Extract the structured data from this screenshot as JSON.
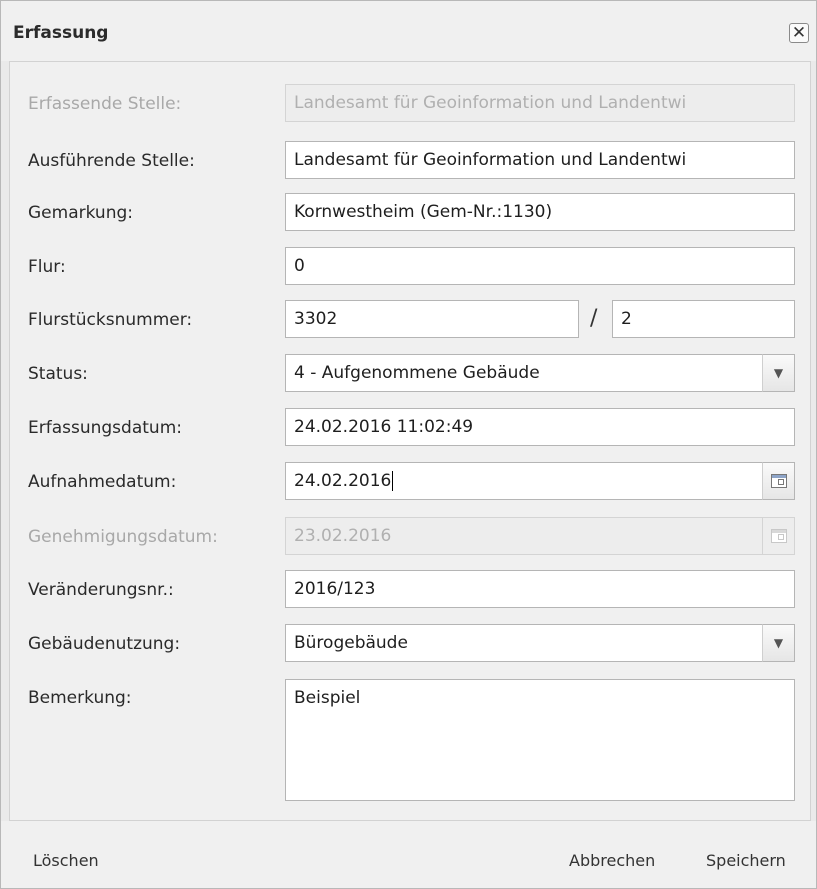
{
  "window": {
    "title": "Erfassung",
    "close_symbol": "✕"
  },
  "form": {
    "erfassende_stelle": {
      "label": "Erfassende Stelle:",
      "value": "Landesamt für Geoinformation und Landentwi"
    },
    "ausfuehrende_stelle": {
      "label": "Ausführende Stelle:",
      "value": "Landesamt für Geoinformation und Landentwi"
    },
    "gemarkung": {
      "label": "Gemarkung:",
      "value": "Kornwestheim (Gem-Nr.:1130)"
    },
    "flur": {
      "label": "Flur:",
      "value": "0"
    },
    "flurstuecksnummer": {
      "label": "Flurstücksnummer:",
      "value_main": "3302",
      "separator": "/",
      "value_sub": "2"
    },
    "status": {
      "label": "Status:",
      "value": "4 - Aufgenommene Gebäude"
    },
    "erfassungsdatum": {
      "label": "Erfassungsdatum:",
      "value": "24.02.2016 11:02:49"
    },
    "aufnahmedatum": {
      "label": "Aufnahmedatum:",
      "value": "24.02.2016"
    },
    "genehmigungsdatum": {
      "label": "Genehmigungsdatum:",
      "value": "23.02.2016"
    },
    "veraenderungsnr": {
      "label": "Veränderungsnr.:",
      "value": "2016/123"
    },
    "gebaeudenutzung": {
      "label": "Gebäudenutzung:",
      "value": "Bürogebäude"
    },
    "bemerkung": {
      "label": "Bemerkung:",
      "value": "Beispiel"
    }
  },
  "footer": {
    "delete": "Löschen",
    "cancel": "Abbrechen",
    "save": "Speichern"
  },
  "icons": {
    "dropdown": "chevron-down-icon",
    "date": "calendar-icon",
    "close": "close-icon"
  }
}
